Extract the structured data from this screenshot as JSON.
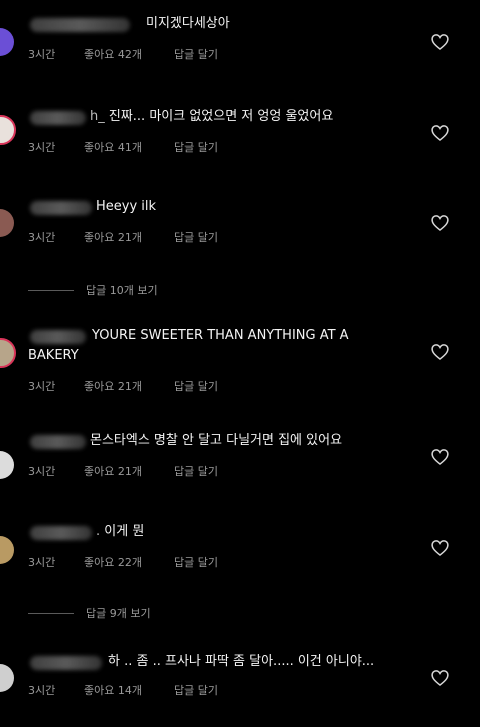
{
  "comments": [
    {
      "text": "미지겠다세상아",
      "time": "3시간",
      "likes": "좋아요 42개",
      "reply": "답글 달기",
      "avatar_color": "#6b4fd6"
    },
    {
      "text": "진짜... 마이크 없었으면 저 엉엉 울었어요",
      "time": "3시간",
      "likes": "좋아요 41개",
      "reply": "답글 달기",
      "avatar_color": "#e9e1dc"
    },
    {
      "text": "Heeyy ilk",
      "time": "3시간",
      "likes": "좋아요 21개",
      "reply": "답글 달기",
      "avatar_color": "#8a5a52"
    },
    {
      "text": "YOURE SWEETER THAN ANYTHING AT A\nBAKERY",
      "time": "3시간",
      "likes": "좋아요 21개",
      "reply": "답글 달기",
      "avatar_color": "#b7a58a"
    },
    {
      "text": "몬스타엑스 명찰 안 달고 다닐거면 집에 있어요",
      "time": "3시간",
      "likes": "좋아요 21개",
      "reply": "답글 달기",
      "avatar_color": "#dcdcdc"
    },
    {
      "text": "이게 뭔",
      "time": "3시간",
      "likes": "좋아요 22개",
      "reply": "답글 달기",
      "avatar_color": "#b99a63"
    },
    {
      "text": "하 .. 좀 .. 프사나 파딱 좀 달아..... 이건 아니야...",
      "time": "3시간",
      "likes": "좋아요 14개",
      "reply": "답글 달기",
      "avatar_color": "#cfcfcf"
    }
  ],
  "view_replies": [
    {
      "label": "답글 10개 보기"
    },
    {
      "label": "답글 9개 보기"
    }
  ],
  "colors": {
    "background": "#000000",
    "text": "#f5f5f5",
    "muted": "#9a9a9a",
    "story_ring": "#d9355a"
  }
}
